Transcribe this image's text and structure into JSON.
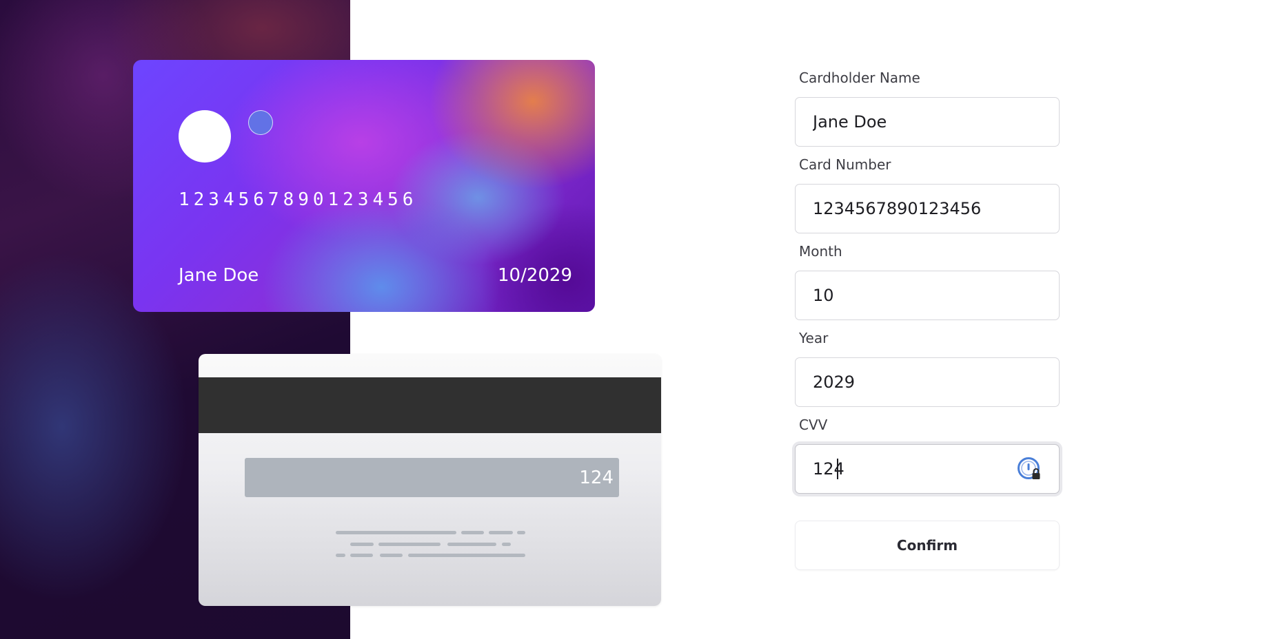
{
  "card_front": {
    "number": "1234567890123456",
    "holder_name": "Jane Doe",
    "expiry": "10/2029"
  },
  "card_back": {
    "cvv": "124"
  },
  "form": {
    "cardholder_name": {
      "label": "Cardholder Name",
      "value": "Jane Doe"
    },
    "card_number": {
      "label": "Card Number",
      "value": "1234567890123456"
    },
    "month": {
      "label": "Month",
      "value": "10"
    },
    "year": {
      "label": "Year",
      "value": "2029"
    },
    "cvv": {
      "label": "CVV",
      "value": "124",
      "focused": true
    },
    "confirm_label": "Confirm"
  },
  "colors": {
    "left_panel": "#1d0a2f",
    "card_front_primary": "#7a34f0",
    "card_front_accent": "#e8824a",
    "mag_stripe": "#303030",
    "signature_strip": "#aeb4bc",
    "input_border": "#d6d6db",
    "password_manager_blue": "#4a7fd8"
  },
  "icons": {
    "password_manager": "password-manager-lock-icon"
  }
}
